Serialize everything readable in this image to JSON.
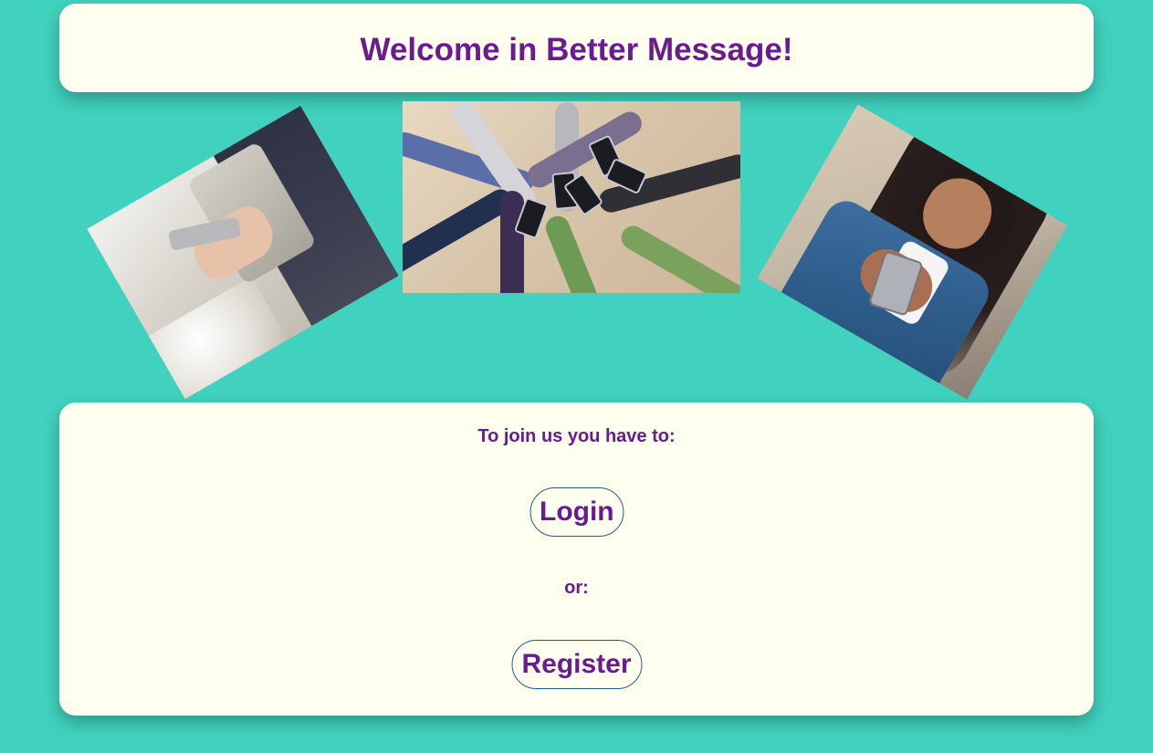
{
  "header": {
    "title": "Welcome in Better Message!"
  },
  "hero": {
    "images": [
      "person-holding-smartphone-photo",
      "group-of-hands-holding-phones-photo",
      "woman-using-smartphone-photo"
    ]
  },
  "join": {
    "prompt": "To join us you have to:",
    "login_label": "Login",
    "or_label": "or:",
    "register_label": "Register"
  },
  "colors": {
    "background": "#40d2be",
    "card": "#fffff0",
    "accent_text": "#6a1b8f",
    "button_border": "#2a5a7a"
  }
}
